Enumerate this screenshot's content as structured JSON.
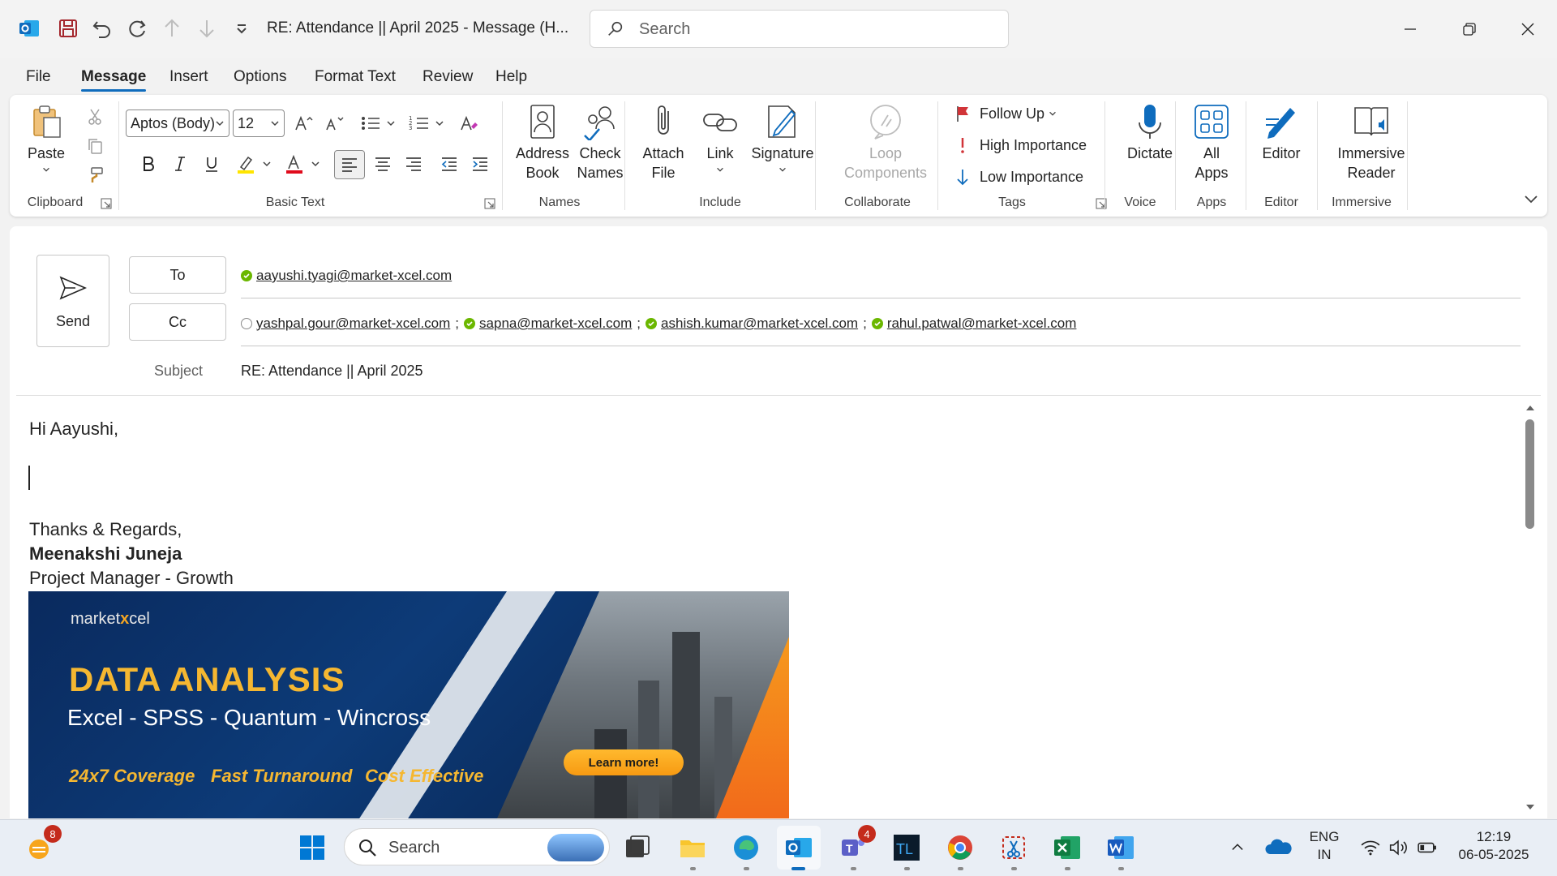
{
  "window": {
    "title": "RE: Attendance || April 2025  -  Message (H...",
    "search_placeholder": "Search"
  },
  "menu": {
    "tabs": [
      "File",
      "Message",
      "Insert",
      "Options",
      "Format Text",
      "Review",
      "Help"
    ],
    "active": "Message"
  },
  "ribbon": {
    "clipboard": {
      "paste": "Paste",
      "group": "Clipboard"
    },
    "basic_text": {
      "font": "Aptos (Body)",
      "size": "12",
      "group": "Basic Text"
    },
    "names": {
      "address_book": [
        "Address",
        "Book"
      ],
      "check_names": [
        "Check",
        "Names"
      ],
      "group": "Names"
    },
    "include": {
      "attach_file": [
        "Attach",
        "File"
      ],
      "link": "Link",
      "signature": "Signature",
      "group": "Include"
    },
    "collaborate": {
      "loop": [
        "Loop",
        "Components"
      ],
      "group": "Collaborate"
    },
    "tags": {
      "follow_up": "Follow Up",
      "high": "High Importance",
      "low": "Low Importance",
      "group": "Tags"
    },
    "voice": {
      "dictate": "Dictate",
      "group": "Voice"
    },
    "apps": {
      "all_apps": [
        "All",
        "Apps"
      ],
      "group": "Apps"
    },
    "editor": {
      "editor": "Editor",
      "group": "Editor"
    },
    "immersive": {
      "reader": [
        "Immersive",
        "Reader"
      ],
      "group": "Immersive"
    }
  },
  "compose": {
    "send": "Send",
    "to_label": "To",
    "cc_label": "Cc",
    "to": [
      "aayushi.tyagi@market-xcel.com"
    ],
    "cc": [
      "yashpal.gour@market-xcel.com",
      "sapna@market-xcel.com",
      "ashish.kumar@market-xcel.com",
      "rahul.patwal@market-xcel.com"
    ],
    "subject_label": "Subject",
    "subject": "RE: Attendance || April 2025"
  },
  "body": {
    "greeting": "Hi Aayushi,",
    "closing": "Thanks & Regards,",
    "name": "Meenakshi Juneja",
    "role": "Project Manager - Growth"
  },
  "banner": {
    "brand_left": "market",
    "brand_x": "x",
    "brand_right": "cel",
    "title": "DATA ANALYSIS",
    "subtitle": "Excel - SPSS - Quantum - Wincross",
    "features": [
      "24x7 Coverage",
      "Fast Turnaround",
      "Cost Effective"
    ],
    "cta": "Learn more!"
  },
  "taskbar": {
    "search": "Search",
    "widget_badge": "8",
    "teams_badge": "4",
    "lang": [
      "ENG",
      "IN"
    ],
    "time": "12:19",
    "date": "06-05-2025"
  },
  "colors": {
    "accent": "#0f6cbd",
    "presence": "#6bb700",
    "banner_gold": "#f5b731"
  }
}
